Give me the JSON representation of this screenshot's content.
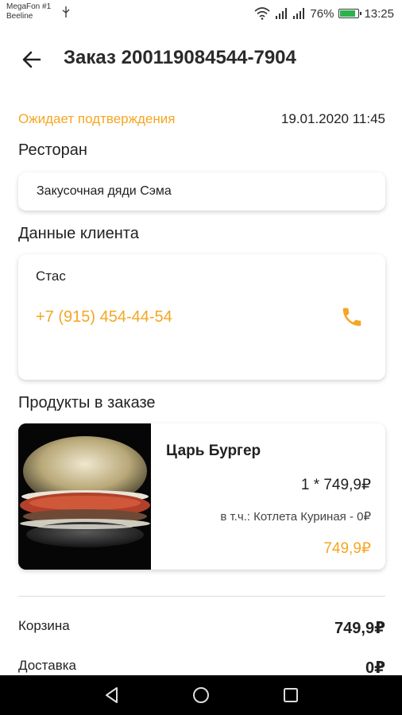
{
  "status_bar": {
    "carrier_line1": "MegaFon #1",
    "carrier_line2": "Beeline",
    "usb_icon": "usb-icon",
    "battery_percent": "76%",
    "battery_level": 0.76,
    "time": "13:25"
  },
  "header": {
    "back_icon": "arrow-left-icon",
    "title": "Заказ 200119084544-7904"
  },
  "order": {
    "status": "Ожидает подтверждения",
    "datetime": "19.01.2020 11:45"
  },
  "restaurant": {
    "section_title": "Ресторан",
    "name": "Закусочная дяди Сэма"
  },
  "client": {
    "section_title": "Данные клиента",
    "name": "Стас",
    "phone": "+7 (915) 454-44-54",
    "phone_icon": "phone-icon"
  },
  "products": {
    "section_title": "Продукты в заказе",
    "items": [
      {
        "name": "Царь Бургер",
        "quantity_line": "1 * 749,9₽",
        "included": "в т.ч.: Котлета Куриная - 0₽",
        "price": "749,9₽"
      }
    ]
  },
  "summary": {
    "rows": [
      {
        "label": "Корзина",
        "value": "749,9₽"
      },
      {
        "label": "Доставка",
        "value": "0₽"
      }
    ]
  },
  "colors": {
    "accent": "#f5a623",
    "text": "#222222",
    "navbar": "#000000"
  },
  "navbar": {
    "back_icon": "triangle-back-icon",
    "home_icon": "circle-home-icon",
    "recents_icon": "square-recents-icon"
  }
}
